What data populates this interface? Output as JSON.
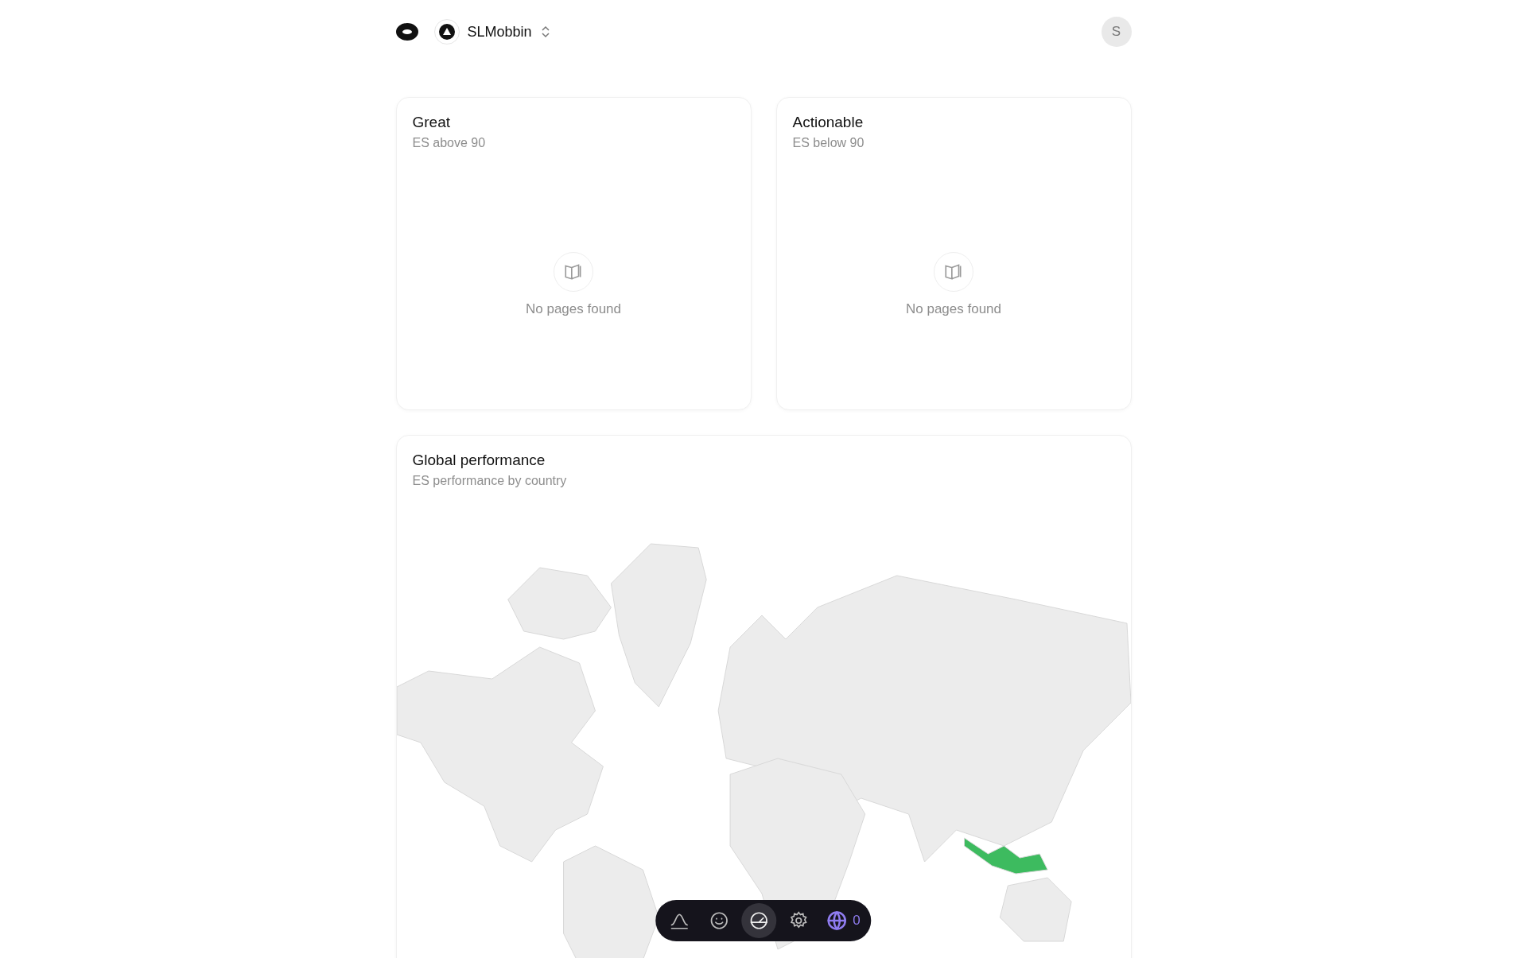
{
  "header": {
    "workspace": "SLMobbin",
    "avatar": "S"
  },
  "cards": [
    {
      "title": "Great",
      "subtitle": "ES above 90",
      "empty": "No pages found"
    },
    {
      "title": "Actionable",
      "subtitle": "ES below 90",
      "empty": "No pages found"
    }
  ],
  "global": {
    "title": "Global performance",
    "subtitle": "ES performance by country"
  },
  "toolbar": [
    {
      "kind": "curve",
      "selected": false
    },
    {
      "kind": "smile",
      "selected": false
    },
    {
      "kind": "gauge",
      "selected": true
    },
    {
      "kind": "gear",
      "selected": false
    },
    {
      "kind": "globe",
      "selected": false,
      "count": "0"
    }
  ]
}
